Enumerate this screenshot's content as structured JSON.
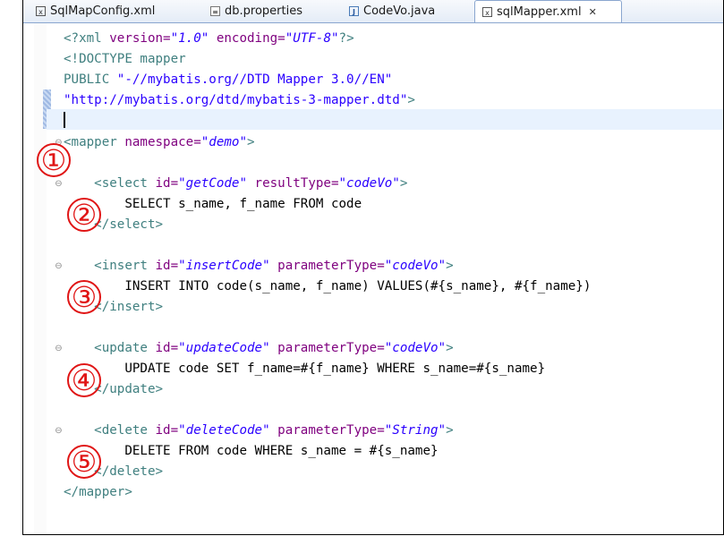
{
  "tabs": [
    {
      "label": "SqlMapConfig.xml",
      "icon": "xml-file-icon"
    },
    {
      "label": "db.properties",
      "icon": "file-icon"
    },
    {
      "label": "CodeVo.java",
      "icon": "java-file-icon"
    },
    {
      "label": "sqlMapper.xml",
      "icon": "xml-file-icon",
      "active": true,
      "close": "✕"
    }
  ],
  "code": {
    "l1": {
      "a": "<?xml ",
      "b": "version=",
      "c": "\"1.0\"",
      "d": " encoding=",
      "e": "\"UTF-8\"",
      "f": "?>"
    },
    "l2": "<!DOCTYPE mapper",
    "l3": {
      "a": "PUBLIC ",
      "b": "\"-//mybatis.org//DTD Mapper 3.0//EN\""
    },
    "l4": {
      "a": "\"http://mybatis.org/dtd/mybatis-3-mapper.dtd\"",
      "b": ">"
    },
    "l6": {
      "a": "<mapper ",
      "b": "namespace=",
      "c": "\"demo\"",
      "d": ">"
    },
    "l8": {
      "a": "<select ",
      "b": "id=",
      "c": "\"getCode\"",
      "d": " resultType=",
      "e": "\"codeVo\"",
      "f": ">"
    },
    "l9": "SELECT s_name, f_name FROM code",
    "l10": "</select>",
    "l12": {
      "a": "<insert ",
      "b": "id=",
      "c": "\"insertCode\"",
      "d": " parameterType=",
      "e": "\"codeVo\"",
      "f": ">"
    },
    "l13": "INSERT INTO code(s_name, f_name) VALUES(#{s_name}, #{f_name})",
    "l14": "</insert>",
    "l16": {
      "a": "<update ",
      "b": "id=",
      "c": "\"updateCode\"",
      "d": " parameterType=",
      "e": "\"codeVo\"",
      "f": ">"
    },
    "l17": "UPDATE code SET f_name=#{f_name} WHERE s_name=#{s_name}",
    "l18": "</update>",
    "l20": {
      "a": "<delete ",
      "b": "id=",
      "c": "\"deleteCode\"",
      "d": " parameterType=",
      "e": "\"String\"",
      "f": ">"
    },
    "l21": "DELETE FROM code WHERE s_name = #{s_name}",
    "l22": "</delete>",
    "l23": "</mapper>"
  },
  "annotations": [
    "①",
    "②",
    "③",
    "④",
    "⑤"
  ],
  "colors": {
    "tag": "#3f7f7f",
    "attr": "#7f007f",
    "string": "#2a00ff",
    "annotation": "#e01515",
    "current_line": "#e8f2fe"
  }
}
